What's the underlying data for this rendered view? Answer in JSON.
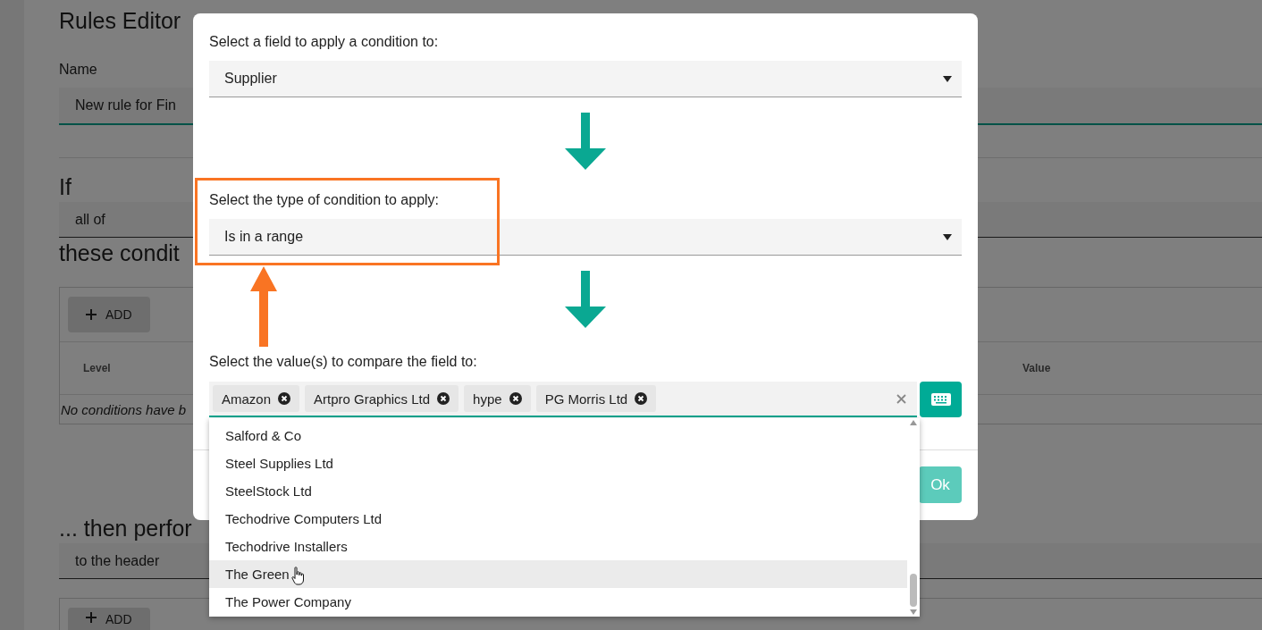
{
  "page": {
    "title": "Rules Editor",
    "name_label": "Name",
    "name_value": "New rule for Fin",
    "if_heading": "If",
    "match_select": "all of",
    "conditions_heading": "these condit",
    "add_button": "ADD",
    "columns": [
      {
        "label": "Level"
      },
      {
        "label": "Value"
      }
    ],
    "empty_message": "No conditions have b",
    "then_heading": "... then perfor",
    "target_select": "to the header",
    "add_button_2": "ADD"
  },
  "dialog": {
    "field_label": "Select a field to apply a condition to:",
    "field_value": "Supplier",
    "type_label": "Select the type of condition to apply:",
    "type_value": "Is in a range",
    "values_label": "Select the value(s) to compare the field to:",
    "tags": [
      {
        "label": "Amazon"
      },
      {
        "label": "Artpro Graphics Ltd"
      },
      {
        "label": "hype"
      },
      {
        "label": "PG Morris Ltd"
      }
    ],
    "ok_button": {
      "label": "Ok",
      "disabled": true
    },
    "options": [
      {
        "label": "Salford & Co",
        "selected": false
      },
      {
        "label": "Steel Supplies Ltd",
        "selected": false
      },
      {
        "label": "SteelStock Ltd",
        "selected": false
      },
      {
        "label": "Techodrive Computers Ltd",
        "selected": false
      },
      {
        "label": "Techodrive Installers",
        "selected": false
      },
      {
        "label": "The Green",
        "selected": true
      },
      {
        "label": "The Power Company",
        "selected": false
      }
    ]
  }
}
